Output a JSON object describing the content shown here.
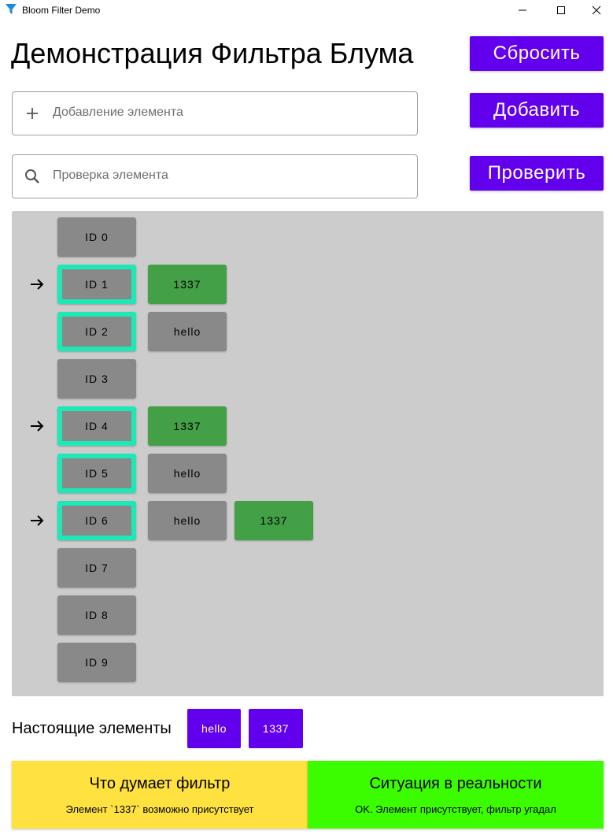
{
  "window": {
    "title": "Bloom Filter Demo"
  },
  "header": {
    "title": "Демонстрация Фильтра Блума"
  },
  "buttons": {
    "reset": "Сбросить",
    "add": "Добавить",
    "check": "Проверить"
  },
  "inputs": {
    "add": {
      "placeholder": "Добавление элемента",
      "value": ""
    },
    "check": {
      "placeholder": "Проверка элемента",
      "value": ""
    }
  },
  "rows": [
    {
      "id": "ID 0",
      "highlighted": false,
      "arrow": false,
      "items": []
    },
    {
      "id": "ID 1",
      "highlighted": true,
      "arrow": true,
      "items": [
        {
          "text": "1337",
          "match": true
        }
      ]
    },
    {
      "id": "ID 2",
      "highlighted": true,
      "arrow": false,
      "items": [
        {
          "text": "hello",
          "match": false
        }
      ]
    },
    {
      "id": "ID 3",
      "highlighted": false,
      "arrow": false,
      "items": []
    },
    {
      "id": "ID 4",
      "highlighted": true,
      "arrow": true,
      "items": [
        {
          "text": "1337",
          "match": true
        }
      ]
    },
    {
      "id": "ID 5",
      "highlighted": true,
      "arrow": false,
      "items": [
        {
          "text": "hello",
          "match": false
        }
      ]
    },
    {
      "id": "ID 6",
      "highlighted": true,
      "arrow": true,
      "items": [
        {
          "text": "hello",
          "match": false
        },
        {
          "text": "1337",
          "match": true
        }
      ]
    },
    {
      "id": "ID 7",
      "highlighted": false,
      "arrow": false,
      "items": []
    },
    {
      "id": "ID 8",
      "highlighted": false,
      "arrow": false,
      "items": []
    },
    {
      "id": "ID 9",
      "highlighted": false,
      "arrow": false,
      "items": []
    }
  ],
  "real_elements": {
    "label": "Настоящие элементы",
    "items": [
      "hello",
      "1337"
    ]
  },
  "status": {
    "filter": {
      "heading": "Что думает фильтр",
      "text": "Элемент `1337` возможно присутствует",
      "color": "#ffe23f"
    },
    "reality": {
      "heading": "Ситуация в реальности",
      "text": "OK. Элемент присутствует, фильтр угадал",
      "color": "#3cfd00"
    }
  },
  "colors": {
    "accent": "#6200ee",
    "highlight": "#1de9b6",
    "match": "#43a047",
    "cell": "#898989",
    "panel": "#cccccc"
  }
}
